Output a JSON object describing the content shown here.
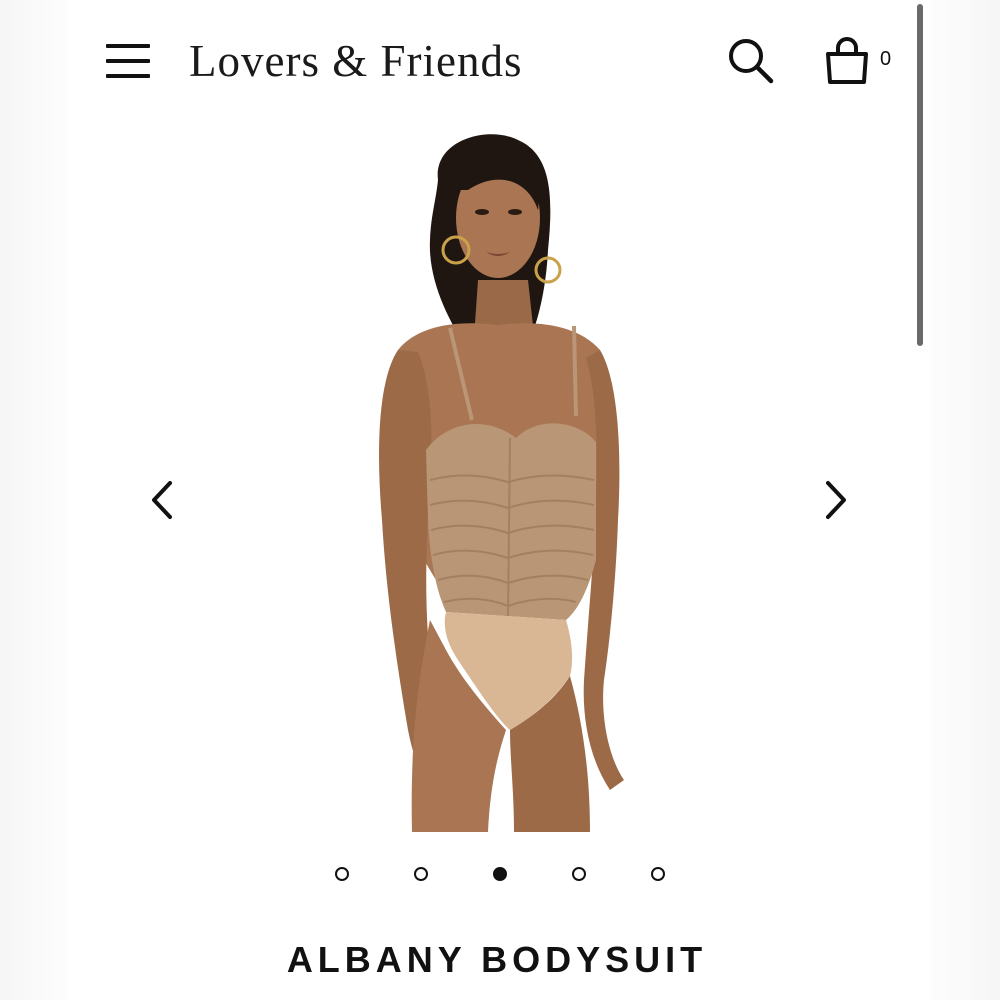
{
  "header": {
    "brand": "Lovers & Friends",
    "menu_icon": "hamburger-menu-icon",
    "search_icon": "search-icon",
    "bag_icon": "shopping-bag-icon",
    "bag_count": "0"
  },
  "carousel": {
    "prev_icon": "chevron-left-icon",
    "next_icon": "chevron-right-icon",
    "image_subject": "model wearing tan ruched bodysuit",
    "slide_count": 5,
    "active_slide": 3
  },
  "product": {
    "title": "ALBANY BODYSUIT"
  },
  "colors": {
    "text": "#111111",
    "bodysuit": "#b89676",
    "bodysuit_base": "#d9b694",
    "skin": "#a97552",
    "hair": "#1f1612"
  }
}
